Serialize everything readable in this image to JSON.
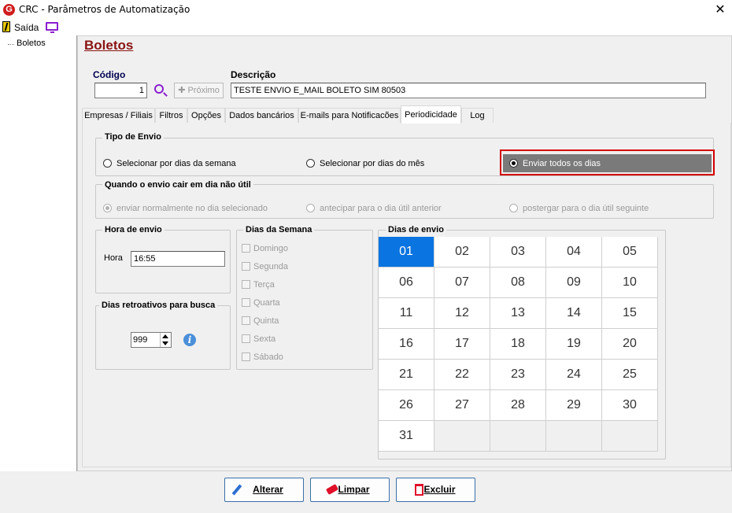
{
  "window": {
    "title": "CRC - Parâmetros de Automatização",
    "app_icon_letter": "G",
    "close_glyph": "✕"
  },
  "menu": {
    "saida_label": "Saída"
  },
  "tree": {
    "items": [
      "Boletos"
    ]
  },
  "page": {
    "heading": "Boletos",
    "codigo_label": "Código",
    "codigo_value": "1",
    "proximo_label": "Próximo",
    "descricao_label": "Descrição",
    "descricao_value": "TESTE ENVIO  E_MAIL BOLETO SIM 80503"
  },
  "tabs": [
    "Empresas / Filiais",
    "Filtros",
    "Opções",
    "Dados bancários",
    "E-mails para Notificacões",
    "Periodicidade",
    "Log"
  ],
  "active_tab": "Periodicidade",
  "tipo_envio": {
    "title": "Tipo de Envio",
    "options": [
      "Selecionar por dias da semana",
      "Selecionar por dias do mês",
      "Enviar todos os dias"
    ],
    "selected": "Enviar todos os dias"
  },
  "dia_nao_util": {
    "title": "Quando o envio cair em dia não útil",
    "options": [
      "enviar normalmente no dia selecionado",
      "antecipar para o dia útil anterior",
      "postergar para o dia útil seguinte"
    ],
    "selected": "enviar normalmente no dia selecionado"
  },
  "hora_envio": {
    "title": "Hora de envio",
    "label": "Hora",
    "value": "16:55"
  },
  "dias_retroativos": {
    "title": "Dias retroativos para busca",
    "value": "999"
  },
  "dias_semana": {
    "title": "Dias da Semana",
    "days": [
      "Domingo",
      "Segunda",
      "Terça",
      "Quarta",
      "Quinta",
      "Sexta",
      "Sábado"
    ]
  },
  "dias_envio": {
    "title": "Dias de envio",
    "days": [
      "01",
      "02",
      "03",
      "04",
      "05",
      "06",
      "07",
      "08",
      "09",
      "10",
      "11",
      "12",
      "13",
      "14",
      "15",
      "16",
      "17",
      "18",
      "19",
      "20",
      "21",
      "22",
      "23",
      "24",
      "25",
      "26",
      "27",
      "28",
      "29",
      "30",
      "31"
    ],
    "selected": "01"
  },
  "buttons": {
    "alterar": "Alterar",
    "limpar": "Limpar",
    "excluir": "Excluir"
  },
  "colors": {
    "heading": "#8b1313",
    "selected_day": "#0a74e0",
    "highlight_border": "#d40000",
    "icon_purple": "#8b1fd0"
  }
}
